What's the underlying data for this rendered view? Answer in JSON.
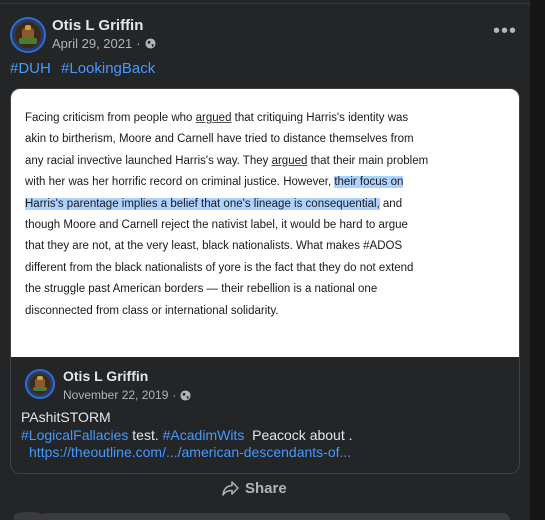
{
  "post": {
    "author": "Otis L Griffin",
    "date": "April 29, 2021",
    "separator": "·",
    "privacy_icon": "globe-icon",
    "more_icon": "more-horizontal-icon",
    "hashtags": [
      "#DUH",
      "#LookingBack"
    ]
  },
  "excerpt": {
    "lines": [
      {
        "parts": [
          {
            "t": "Facing criticism from people who "
          },
          {
            "t": "argued",
            "u": true
          },
          {
            "t": " that critiquing Harris's identity was"
          }
        ]
      },
      {
        "parts": [
          {
            "t": "akin to birtherism, Moore and Carnell have tried to distance themselves from"
          }
        ]
      },
      {
        "parts": [
          {
            "t": "any racial invective launched Harris's way. They "
          },
          {
            "t": "argued",
            "u": true
          },
          {
            "t": " that their main problem"
          }
        ]
      },
      {
        "parts": [
          {
            "t": "with her was her horrific record on criminal justice. However, "
          },
          {
            "t": "their focus on",
            "h": true
          }
        ]
      },
      {
        "parts": [
          {
            "t": "Harris's parentage implies a belief that one's lineage is consequential,",
            "h": true
          },
          {
            "t": " and"
          }
        ]
      },
      {
        "parts": [
          {
            "t": "though Moore and Carnell reject the nativist label, it would be hard to argue"
          }
        ]
      },
      {
        "parts": [
          {
            "t": "that they are not, at the very least, black nationalists. What makes #ADOS"
          }
        ]
      },
      {
        "parts": [
          {
            "t": "different from the black nationalists of yore is the fact that they do not extend"
          }
        ]
      },
      {
        "parts": [
          {
            "t": "the struggle past American borders — their rebellion is a national one"
          }
        ]
      },
      {
        "parts": [
          {
            "t": "disconnected from class or international solidarity."
          }
        ]
      }
    ]
  },
  "shared": {
    "author": "Otis L Griffin",
    "date": "November 22, 2019",
    "separator": "·",
    "line1": "PAshitSTORM",
    "line2_tag1": "#LogicalFallacies",
    "line2_text1": " test. ",
    "line2_tag2": "#AcadimWits",
    "line2_text2": "  Peacock about .",
    "link": "https://theoutline.com/.../american-descendants-of..."
  },
  "actions": {
    "share_label": "Share",
    "share_icon": "share-arrow-icon"
  },
  "colors": {
    "background": "#242526",
    "link": "#4599ff",
    "highlight": "#aed2ff",
    "avatar_ring": "#2d6cdf"
  }
}
